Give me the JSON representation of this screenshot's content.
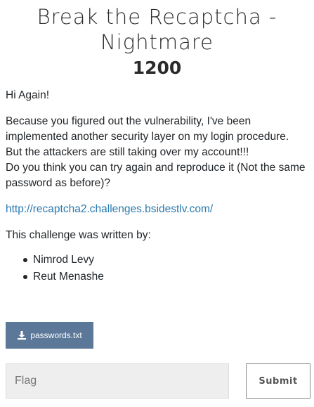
{
  "challenge": {
    "name": "Break the Recaptcha - Nightmare",
    "value": "1200"
  },
  "description": {
    "greeting": "Hi Again!",
    "paragraph_lines": [
      "Because you figured out the vulnerability, I've been",
      "implemented another security layer on my login procedure.",
      "But the attackers are still taking over my account!!!",
      "Do you think you can try again and reproduce it (Not the same",
      "password as before)?"
    ],
    "link": "http://recaptcha2.challenges.bsidestlv.com/",
    "written_by": "This challenge was written by:",
    "authors": [
      "Nimrod Levy",
      "Reut Menashe"
    ]
  },
  "file": {
    "label": "passwords.txt",
    "icon": "download-icon"
  },
  "form": {
    "flag_placeholder": "Flag",
    "submit_label": "Submit"
  },
  "colors": {
    "file_button": "#5c7899",
    "link": "#2a7ab0"
  }
}
